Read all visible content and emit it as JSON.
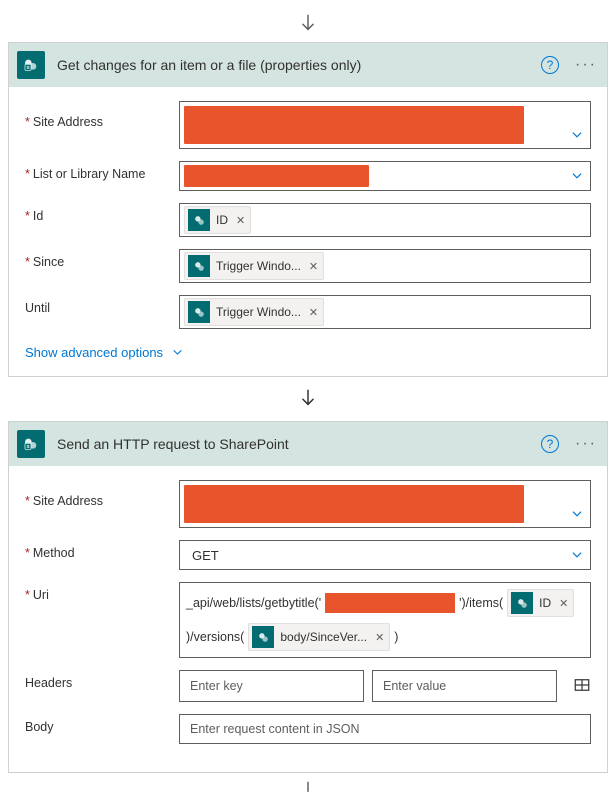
{
  "card1": {
    "title": "Get changes for an item or a file (properties only)",
    "fields": {
      "siteAddress": "Site Address",
      "listLibrary": "List or Library Name",
      "id": "Id",
      "since": "Since",
      "until": "Until"
    },
    "tokens": {
      "id": "ID",
      "since": "Trigger Windo...",
      "until": "Trigger Windo..."
    },
    "showAdvanced": "Show advanced options"
  },
  "card2": {
    "title": "Send an HTTP request to SharePoint",
    "fields": {
      "siteAddress": "Site Address",
      "method": "Method",
      "uri": "Uri",
      "headers": "Headers",
      "body": "Body"
    },
    "methodValue": "GET",
    "uri": {
      "part1": "_api/web/lists/getbytitle('",
      "part2": "')/items(",
      "part3": ")/versions(",
      "part4": ")",
      "tokenId": "ID",
      "tokenSince": "body/SinceVer..."
    },
    "headers": {
      "keyPlaceholder": "Enter key",
      "valuePlaceholder": "Enter value"
    },
    "bodyPlaceholder": "Enter request content in JSON"
  }
}
